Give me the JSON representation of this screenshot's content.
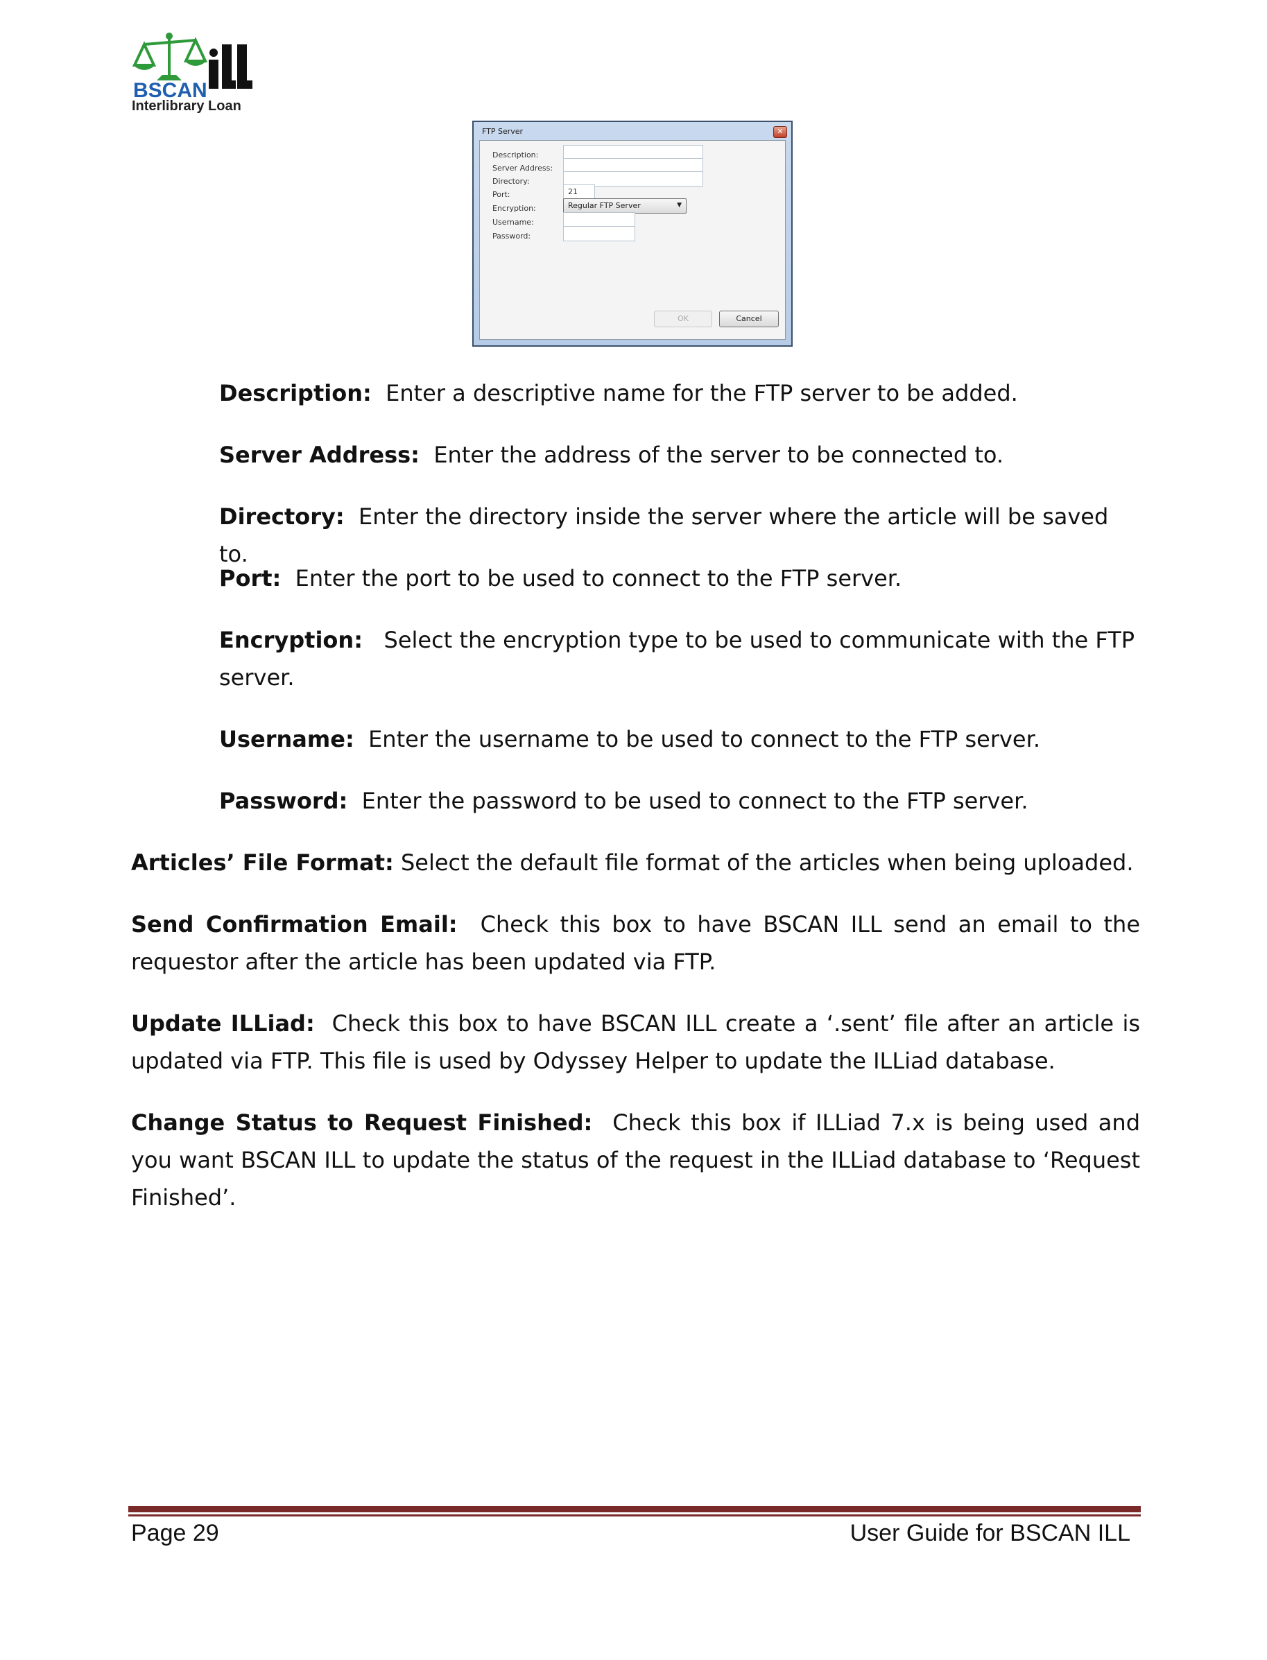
{
  "logo": {
    "name": "BSCAN",
    "subtitle": "Interlibrary Loan"
  },
  "dialog": {
    "title": "FTP Server",
    "fields": [
      {
        "label": "Description:",
        "value": ""
      },
      {
        "label": "Server Address:",
        "value": ""
      },
      {
        "label": "Directory:",
        "value": ""
      },
      {
        "label": "Port:",
        "value": "21"
      },
      {
        "label": "Encryption:",
        "value": "Regular FTP Server"
      },
      {
        "label": "Username:",
        "value": ""
      },
      {
        "label": "Password:",
        "value": ""
      }
    ],
    "ok_label": "OK",
    "cancel_label": "Cancel"
  },
  "definitions": [
    {
      "term": "Description:",
      "text": "Enter a descriptive name for the FTP server to be added."
    },
    {
      "term": "Server Address:",
      "text": "Enter the address of the server to be connected to."
    },
    {
      "term": "Directory:",
      "text": "Enter the directory inside the server where the article will be saved to."
    },
    {
      "term": "Port:",
      "text": "Enter the port to be used to connect to the FTP server."
    },
    {
      "term": "Encryption:",
      "text": "Select the encryption type to be used to communicate with the FTP server."
    },
    {
      "term": "Username:",
      "text": "Enter the username to be used to connect to the FTP server."
    },
    {
      "term": "Password:",
      "text": "Enter the password to be used to connect to the FTP server."
    }
  ],
  "options": [
    {
      "term": "Articles’ File Format:",
      "text": "Select the default file format of the articles when being uploaded."
    },
    {
      "term": "Send Confirmation Email:",
      "text": "Check this box to have BSCAN ILL send an email to the requestor after the article has been updated via FTP."
    },
    {
      "term": "Update ILLiad:",
      "text": "Check this box to have BSCAN ILL create a ‘.sent’ file after an article is updated via FTP.  This file is used by Odyssey Helper to update the ILLiad database."
    },
    {
      "term": "Change Status to Request Finished:",
      "text": "Check this box if ILLiad 7.x is being used and you want BSCAN ILL to update the status of the request in the ILLiad database to ‘Request Finished’."
    }
  ],
  "footer": {
    "page": "Page 29",
    "guide": "User Guide for BSCAN ILL"
  },
  "colors": {
    "footer_rule": "#7b2a2a",
    "logo_green": "#2e9a3a",
    "logo_blue": "#1f5fb0"
  }
}
